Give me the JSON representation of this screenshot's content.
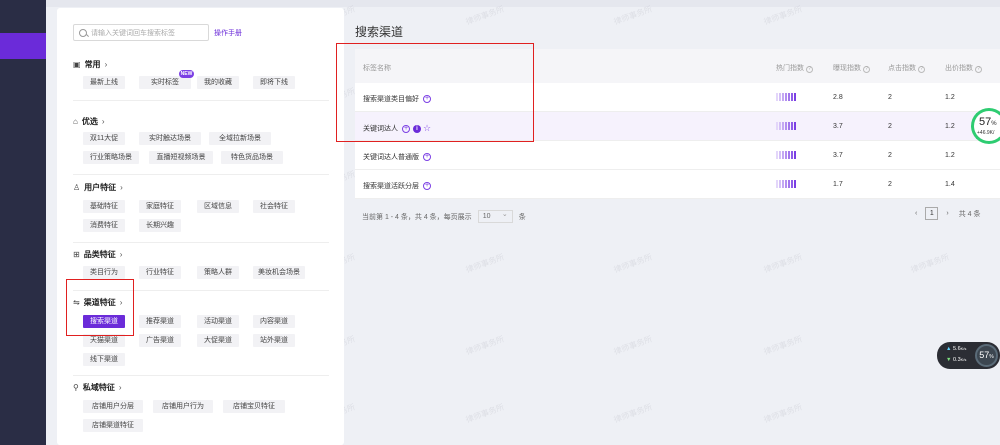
{
  "search": {
    "placeholder": "请输入关键词回车搜索标签"
  },
  "manual_link": "操作手册",
  "sections": {
    "common": {
      "title": "常用",
      "tags": [
        "最新上线",
        "实时标签",
        "我的收藏",
        "即将下线"
      ],
      "new_badge": "NEW"
    },
    "preferred": {
      "title": "优选",
      "tags": [
        "双11大促",
        "实时触达场景",
        "全域拉新场景",
        "行业策略场景",
        "直播短视频场景",
        "特色货品场景"
      ]
    },
    "user": {
      "title": "用户特征",
      "tags": [
        "基础特征",
        "家庭特征",
        "区域信息",
        "社会特征",
        "消费特征",
        "长期兴趣"
      ]
    },
    "category": {
      "title": "品类特征",
      "tags": [
        "类目行为",
        "行业特征",
        "策略人群",
        "美妆机会场景"
      ]
    },
    "channel": {
      "title": "渠道特征",
      "tags": [
        "搜索渠道",
        "推荐渠道",
        "活动渠道",
        "内容渠道",
        "天猫渠道",
        "广告渠道",
        "大促渠道",
        "站外渠道",
        "线下渠道"
      ]
    },
    "private": {
      "title": "私域特征",
      "tags": [
        "店铺用户分层",
        "店铺用户行为",
        "店铺宝贝特征",
        "店铺渠道特征"
      ]
    }
  },
  "main": {
    "title": "搜索渠道",
    "headers": {
      "name": "标签名称",
      "hot": "热门指数",
      "exposure": "曝现指数",
      "click": "点击指数",
      "bid": "出价指数"
    },
    "rows": [
      {
        "name": "搜索渠道类目偏好",
        "exposure": "2.8",
        "click": "2",
        "bid": "1.2"
      },
      {
        "name": "关键词达人",
        "exposure": "3.7",
        "click": "2",
        "bid": "1.2"
      },
      {
        "name": "关键词达人普通版",
        "exposure": "3.7",
        "click": "2",
        "bid": "1.2"
      },
      {
        "name": "搜索渠道活跃分层",
        "exposure": "1.7",
        "click": "2",
        "bid": "1.4"
      }
    ],
    "pager": {
      "summary": "当前第 1 - 4 条，共 4 条，每页展示",
      "page_size": "10",
      "unit": "条",
      "page": "1",
      "total": "共 4 条"
    }
  },
  "perf_ring": {
    "percent": "57",
    "suffix": "%",
    "speed": "+46.9K/"
  },
  "net_widget": {
    "up": "5.6",
    "up_unit": "K/s",
    "down": "0.3",
    "down_unit": "K/s",
    "percent": "57",
    "percent_unit": "%"
  },
  "watermark": "律师事务所",
  "colors": {
    "accent": "#6b2bd9",
    "nav_bg": "#2a2d45",
    "highlight_box": "#e02020"
  }
}
